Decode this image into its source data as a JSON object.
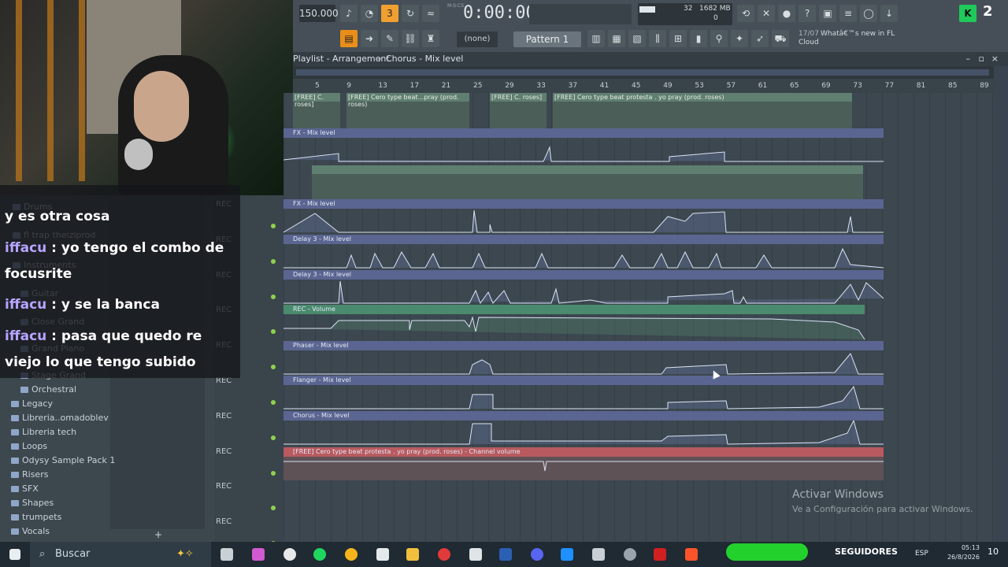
{
  "toolbar": {
    "bpm": "150.000",
    "time": "0:00:00",
    "time_label": "M:S:CS",
    "cpu": "32",
    "mem": "1682 MB",
    "mem_sub": "0",
    "pattern_none": "(none)",
    "pattern": "Pattern 1",
    "news_date": "17/07",
    "news_text": "Whatâ€™s new in FL",
    "news_sub": "Cloud",
    "badge": "2"
  },
  "playlist": {
    "breadcrumb": "Playlist - Arrangement",
    "breadcrumb_sep": "›",
    "breadcrumb_current": "Chorus - Mix level",
    "ruler": [
      "5",
      "9",
      "13",
      "17",
      "21",
      "25",
      "29",
      "33",
      "37",
      "41",
      "45",
      "49",
      "53",
      "57",
      "61",
      "65",
      "69",
      "73",
      "77",
      "81",
      "85",
      "89"
    ]
  },
  "clips": {
    "audio1_a": "[FREE] C. roses]",
    "audio1_b": "[FREE] Cero type beat...pray (prod. roses)",
    "audio1_c": "[FREE] C. roses]",
    "audio1_d": "[FREE] Cero type beat protesta . yo pray (prod. roses)",
    "fx1": "FX - Mix level",
    "fx2": "FX - Mix level",
    "delay1": "Delay 3 - Mix level",
    "delay2": "Delay 3 - Mix level",
    "rec_volume": "REC - Volume",
    "phaser": "Phaser - Mix level",
    "flanger": "Flanger - Mix level",
    "chorus": "Chorus - Mix level",
    "channel_volume": "[FREE] Cero type beat protesta . yo pray (prod. roses) - Channel volume"
  },
  "track_labels": [
    "REC",
    "REC",
    "REC",
    "REC",
    "REC",
    "REC",
    "REC",
    "REC",
    "REC",
    "REC"
  ],
  "browser": {
    "items": [
      {
        "label": "Drums"
      },
      {
        "label": "fl trap theizlprod"
      },
      {
        "label": "Instruments"
      },
      {
        "label": "Guitar"
      },
      {
        "label": "Close Grand"
      },
      {
        "label": "Grand Piano"
      },
      {
        "label": "Stage Grand"
      },
      {
        "label": "Orchestral"
      },
      {
        "label": "Legacy"
      },
      {
        "label": "Libreria..omadoblev"
      },
      {
        "label": "Libreria tech"
      },
      {
        "label": "Loops"
      },
      {
        "label": "Odysy Sample Pack 1"
      },
      {
        "label": "Risers"
      },
      {
        "label": "SFX"
      },
      {
        "label": "Shapes"
      },
      {
        "label": "trumpets"
      },
      {
        "label": "Vocals"
      }
    ],
    "add_glyph": "+"
  },
  "chat": {
    "messages": [
      {
        "user": "",
        "text": "y es otra cosa"
      },
      {
        "user": "iffacu",
        "text": " : yo tengo el combo de focusrite"
      },
      {
        "user": "iffacu",
        "text": " : y se la banca"
      },
      {
        "user": "iffacu",
        "text": " : pasa que quedo re viejo lo que tengo subido"
      }
    ]
  },
  "watermark": {
    "title": "Activar Windows",
    "subtitle": "Ve a Configuración para activar Windows."
  },
  "taskbar": {
    "search_placeholder": "Buscar",
    "followers_label": "SEGUIDORES",
    "lang": "ESP",
    "time": "05:13",
    "date": "26/8/2026",
    "notif": "10"
  },
  "colors": {
    "accent": "#f0a030",
    "automation_clip": "#5a6591",
    "audio_clip": "#5f7f70",
    "channel_volume_clip": "#b85a5f",
    "followers": "#23d12d"
  }
}
